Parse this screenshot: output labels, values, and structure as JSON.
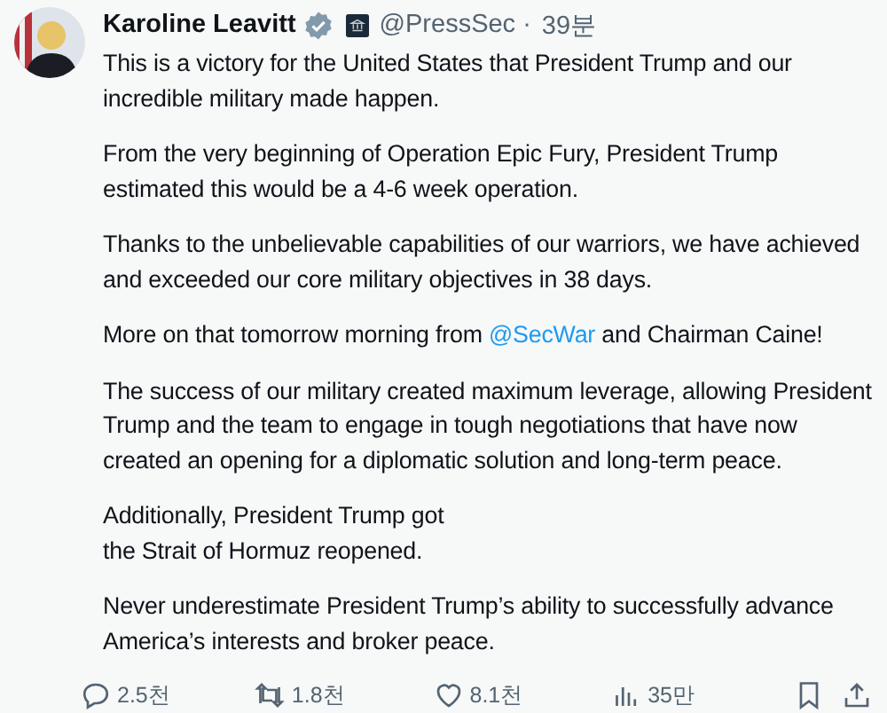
{
  "author": {
    "name": "Karoline Leavitt",
    "verified": true,
    "handle": "@PressSec",
    "separator": "·",
    "time": "39분"
  },
  "paragraphs": [
    {
      "parts": [
        {
          "text": "This is a victory for the United States that President Trump and our incredible military made happen."
        }
      ]
    },
    {
      "parts": [
        {
          "text": "From the very beginning of Operation Epic Fury, President Trump estimated this would be a 4-6 week operation."
        }
      ]
    },
    {
      "parts": [
        {
          "text": "Thanks to the unbelievable capabilities of our warriors, we have achieved and exceeded our core military objectives in 38 days."
        }
      ]
    },
    {
      "parts": [
        {
          "text": "More on that tomorrow morning from "
        },
        {
          "text": "@SecWar",
          "kind": "link"
        },
        {
          "text": " and Chairman Caine!"
        }
      ]
    },
    {
      "parts": [
        {
          "text": "The success of our military created maximum leverage, allowing President Trump and the team to engage in tough negotiations that have now created an opening for a diplomatic solution and long-term peace."
        }
      ]
    },
    {
      "parts": [
        {
          "text": "Additionally, President Trump got\nthe Strait of Hormuz reopened."
        }
      ]
    },
    {
      "parts": [
        {
          "text": "Never underestimate President Trump’s ability to successfully advance America’s interests and broker peace."
        }
      ]
    }
  ],
  "actions": [
    {
      "kind": "reply",
      "count": "2.5천"
    },
    {
      "kind": "repost",
      "count": "1.8천"
    },
    {
      "kind": "like",
      "count": "8.1천"
    },
    {
      "kind": "views",
      "count": "35만"
    },
    {
      "kind": "bookmark"
    },
    {
      "kind": "share"
    }
  ]
}
